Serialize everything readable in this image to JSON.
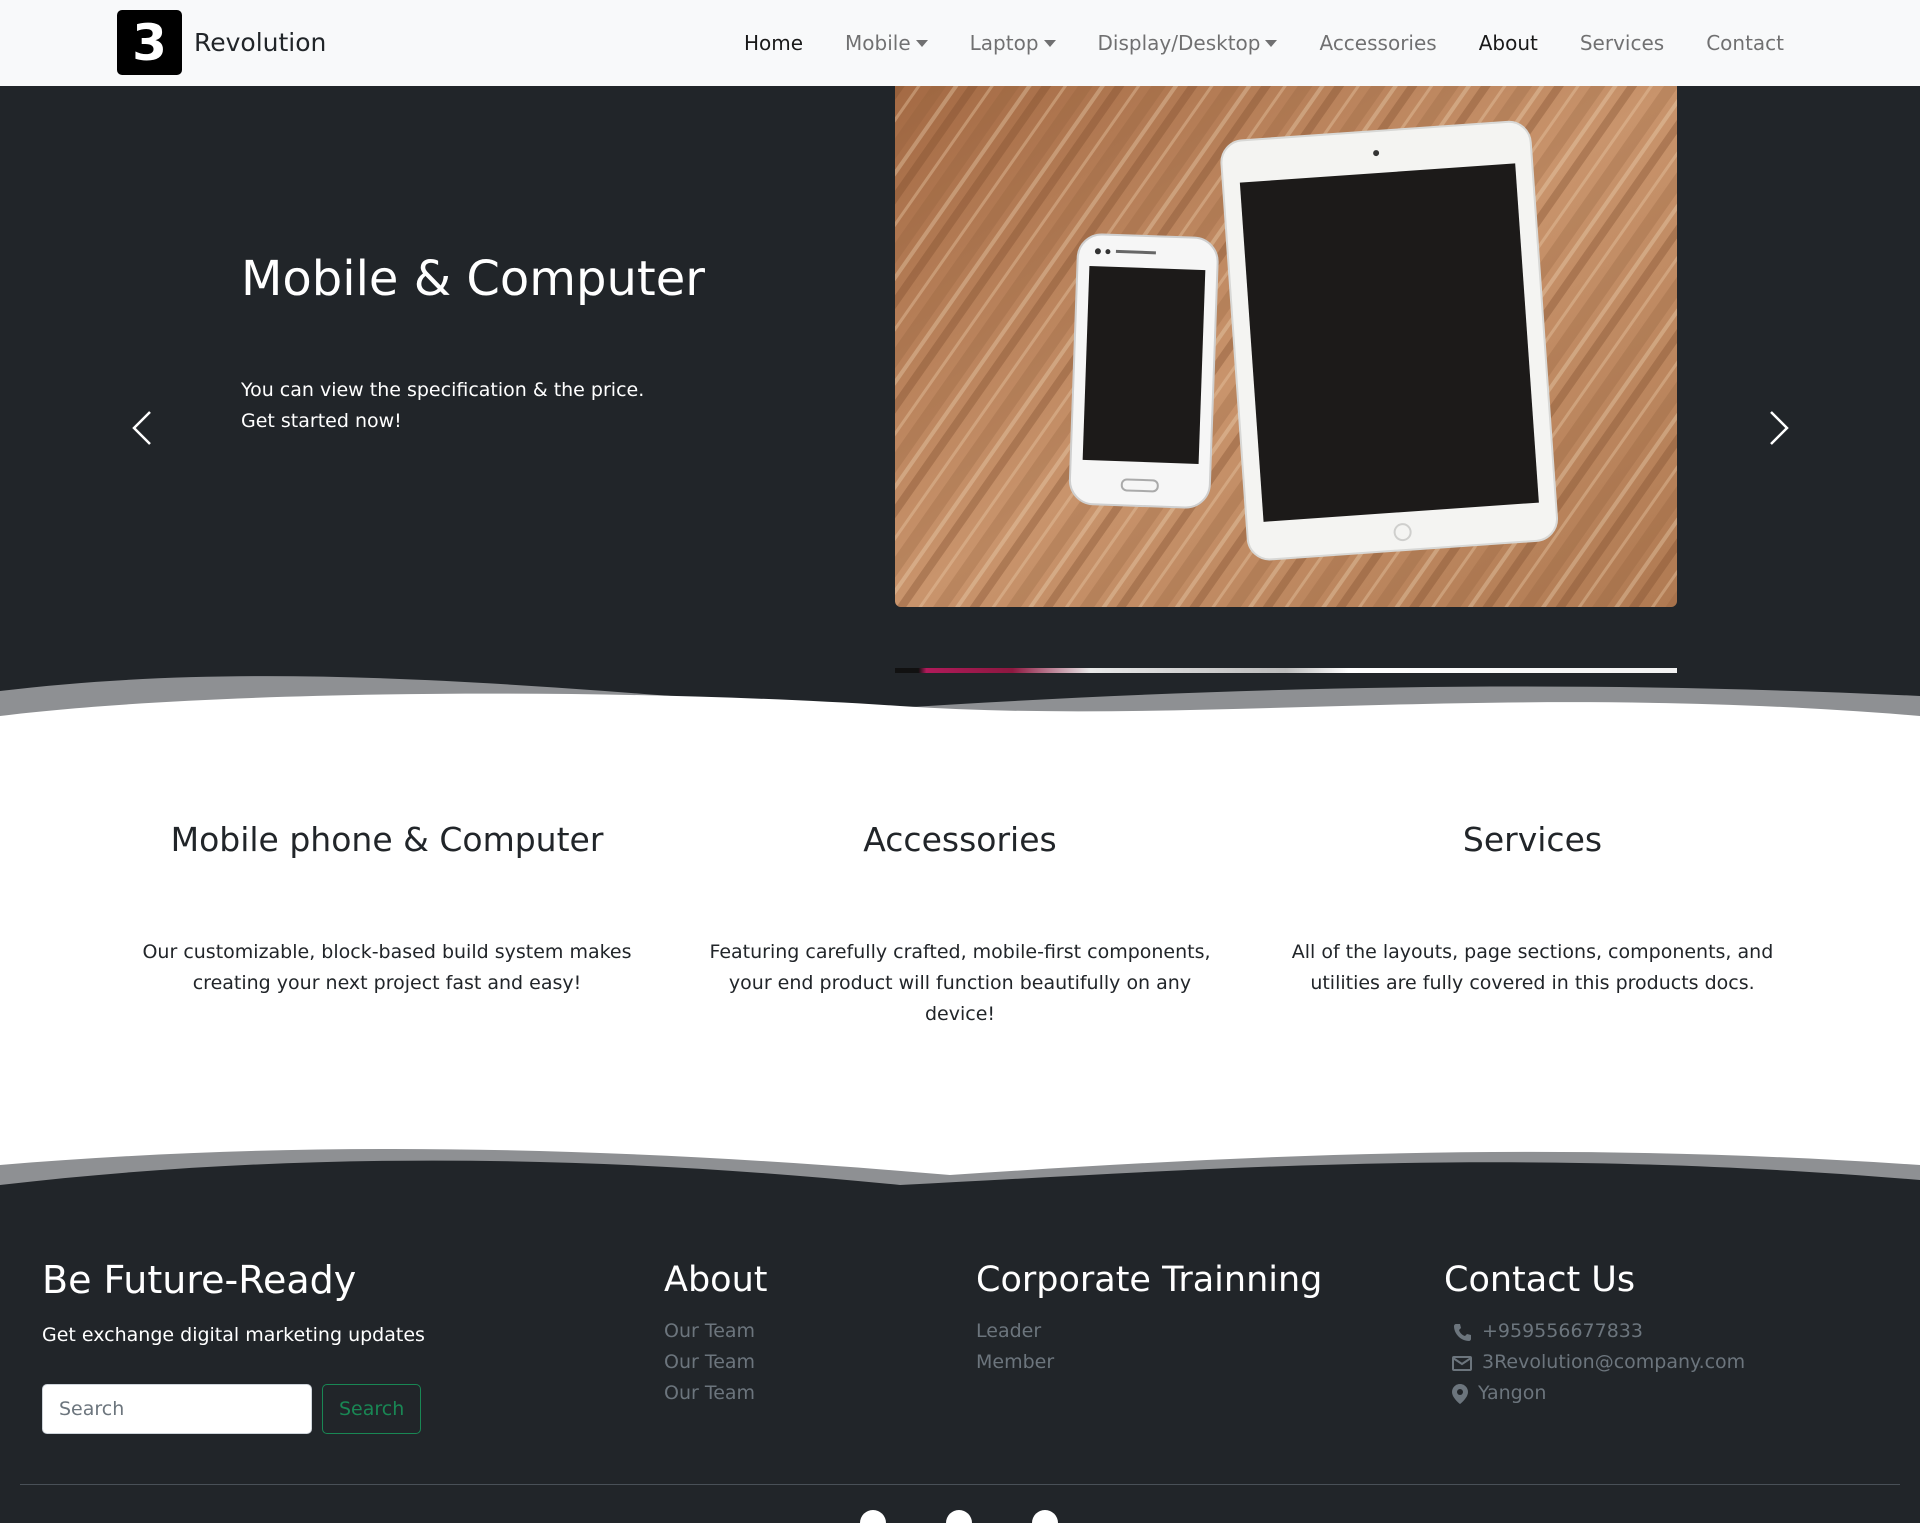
{
  "brand": {
    "logo_char": "3",
    "name": "Revolution"
  },
  "nav": {
    "home": "Home",
    "mobile": "Mobile",
    "laptop": "Laptop",
    "display": "Display/Desktop",
    "accessories": "Accessories",
    "about": "About",
    "services": "Services",
    "contact": "Contact"
  },
  "hero": {
    "title": "Mobile & Computer",
    "line1": "You can view the specification & the price.",
    "line2": "Get started now!"
  },
  "features": [
    {
      "title": "Mobile phone & Computer",
      "text": "Our customizable, block-based build system makes creating your next project fast and easy!"
    },
    {
      "title": "Accessories",
      "text": "Featuring carefully crafted, mobile-first components, your end product will function beautifully on any device!"
    },
    {
      "title": "Services",
      "text": "All of the layouts, page sections, components, and utilities are fully covered in this products docs."
    }
  ],
  "footer": {
    "newsletter": {
      "title": "Be Future-Ready",
      "subtitle": "Get exchange digital marketing updates",
      "search_placeholder": "Search",
      "search_button": "Search"
    },
    "about": {
      "title": "About",
      "links": [
        "Our Team",
        "Our Team",
        "Our Team"
      ]
    },
    "corporate": {
      "title": "Corporate Trainning",
      "links": [
        "Leader",
        "Member"
      ]
    },
    "contact": {
      "title": "Contact Us",
      "phone": "+959556677833",
      "email": "3Revolution@company.com",
      "location": "Yangon"
    }
  },
  "colors": {
    "dark": "#212529",
    "nav_bg": "#f8f9fa",
    "accent_green": "#198754",
    "muted": "#6c757d"
  },
  "icons": [
    "chevron-left-icon",
    "chevron-right-icon",
    "phone-icon",
    "envelope-icon",
    "location-pin-icon"
  ]
}
